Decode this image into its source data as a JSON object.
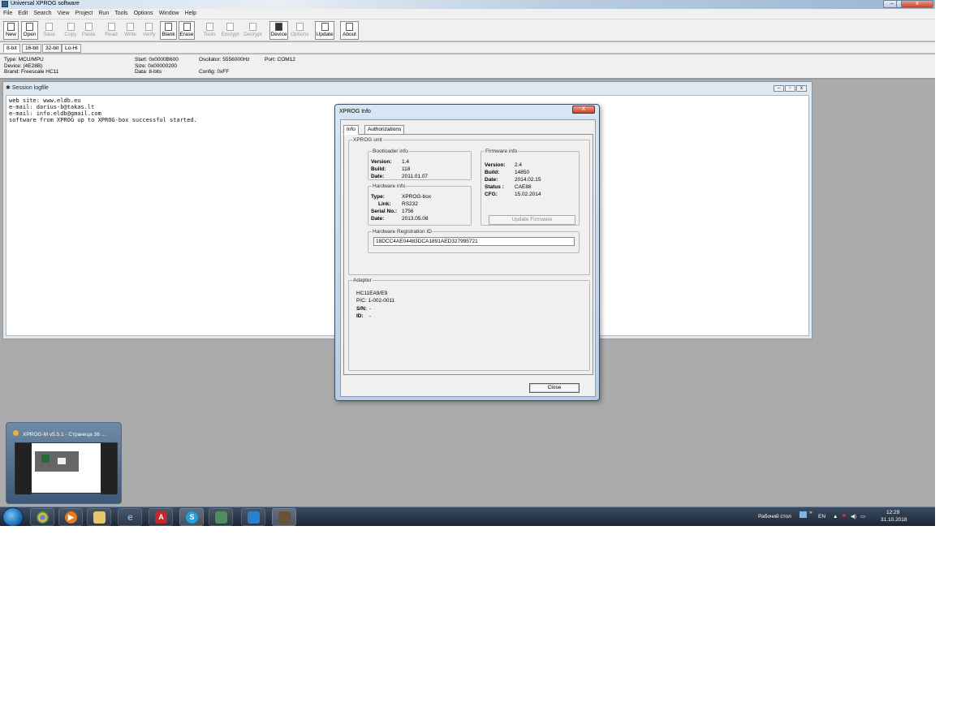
{
  "window": {
    "title": "Universal XPROG software",
    "minimize": "–",
    "restore": "▫",
    "close": "x"
  },
  "menu": [
    "File",
    "Edit",
    "Search",
    "View",
    "Project",
    "Run",
    "Tools",
    "Options",
    "Window",
    "Help"
  ],
  "toolbar": {
    "buttons": [
      {
        "label": "New",
        "enabled": true
      },
      {
        "label": "Open",
        "enabled": true
      },
      {
        "label": "Save",
        "enabled": false
      },
      {
        "label": "Copy",
        "enabled": false
      },
      {
        "label": "Paste",
        "enabled": false
      },
      {
        "label": "Read",
        "enabled": false
      },
      {
        "label": "Write",
        "enabled": false
      },
      {
        "label": "Verify",
        "enabled": false
      },
      {
        "label": "Blank",
        "enabled": true
      },
      {
        "label": "Erase",
        "enabled": true
      },
      {
        "label": "Tools",
        "enabled": false
      },
      {
        "label": "Encrypt",
        "enabled": false
      },
      {
        "label": "Decrypt",
        "enabled": false
      },
      {
        "label": "Device",
        "enabled": true
      },
      {
        "label": "Options",
        "enabled": false
      },
      {
        "label": "Update",
        "enabled": true
      },
      {
        "label": "About",
        "enabled": true
      }
    ]
  },
  "bit_tabs": [
    {
      "label": "8-bit",
      "active": true
    },
    {
      "label": "16-bit",
      "active": false
    },
    {
      "label": "32-bit",
      "active": false
    },
    {
      "label": "Lo-Hi",
      "active": false
    }
  ],
  "device_info": {
    "type": "Type: MCU/MPU",
    "device": "Device: (4E28B)",
    "brand": "Brand: Freescale HC11",
    "start": "Start: 0x0000B600",
    "size": "Size: 0x00000200",
    "data": "Data: 8-bits",
    "oscillator": "Oscilator: 5556000Hz",
    "config": "Config: 0xFF",
    "port": "Port: COM12"
  },
  "session_log": {
    "title": "Session logfile",
    "lines": [
      "web site: www.eldb.eu",
      "e-mail: darius-b@takas.lt",
      "e-mail: info.eldb@gmail.com",
      "software from XPROG up to XPROG-box successful started."
    ]
  },
  "dialog": {
    "title": "XPROG Info",
    "close_x": "X",
    "tabs": [
      "Info",
      "Authorizations"
    ],
    "xprog_unit_label": "XPROG unit",
    "bootloader": {
      "legend": "Bootloader info",
      "version_key": "Version:",
      "version": "1.4",
      "build_key": "Build:",
      "build": "118",
      "date_key": "Date:",
      "date": "2011.01.07"
    },
    "hardware": {
      "legend": "Hardware info",
      "type_key": "Type:",
      "type": "XPROG-box",
      "link_key": "Link:",
      "link": "RS232",
      "serial_key": "Serial No.:",
      "serial": "1756",
      "date_key": "Date:",
      "date": "2013.05.08"
    },
    "firmware": {
      "legend": "Firmware info",
      "version_key": "Version:",
      "version": "2.4",
      "build_key": "Build:",
      "build": "14850",
      "date_key": "Date:",
      "date": "2014.02.15",
      "status_key": "Status :",
      "status": "CAE88",
      "cfg_key": "CFG:",
      "cfg": "15.02.2014",
      "update_button": "Update Firmware"
    },
    "registration": {
      "legend": "Hardware Registration ID",
      "value": "18DCC4AE04483DCA1891AED327995721"
    },
    "adapter": {
      "legend": "Adapter",
      "name": "HC11EA9/E9",
      "pc": "P/C: 1-002-0011",
      "sn_key": "S/N:",
      "sn": "-",
      "id_key": "ID:",
      "id": "-"
    },
    "close_button": "Close"
  },
  "thumbnail": {
    "title": "XPROG-M v5.5.1 - Страница 36 ..."
  },
  "taskbar": {
    "icons": [
      "chrome",
      "media-player",
      "explorer",
      "internet-explorer",
      "acrobat",
      "skype",
      "remote-desktop",
      "app",
      "xprog"
    ],
    "desktop_label": "Рабочий стол",
    "lang": "EN",
    "time": "12:29",
    "date": "31.10.2018"
  }
}
